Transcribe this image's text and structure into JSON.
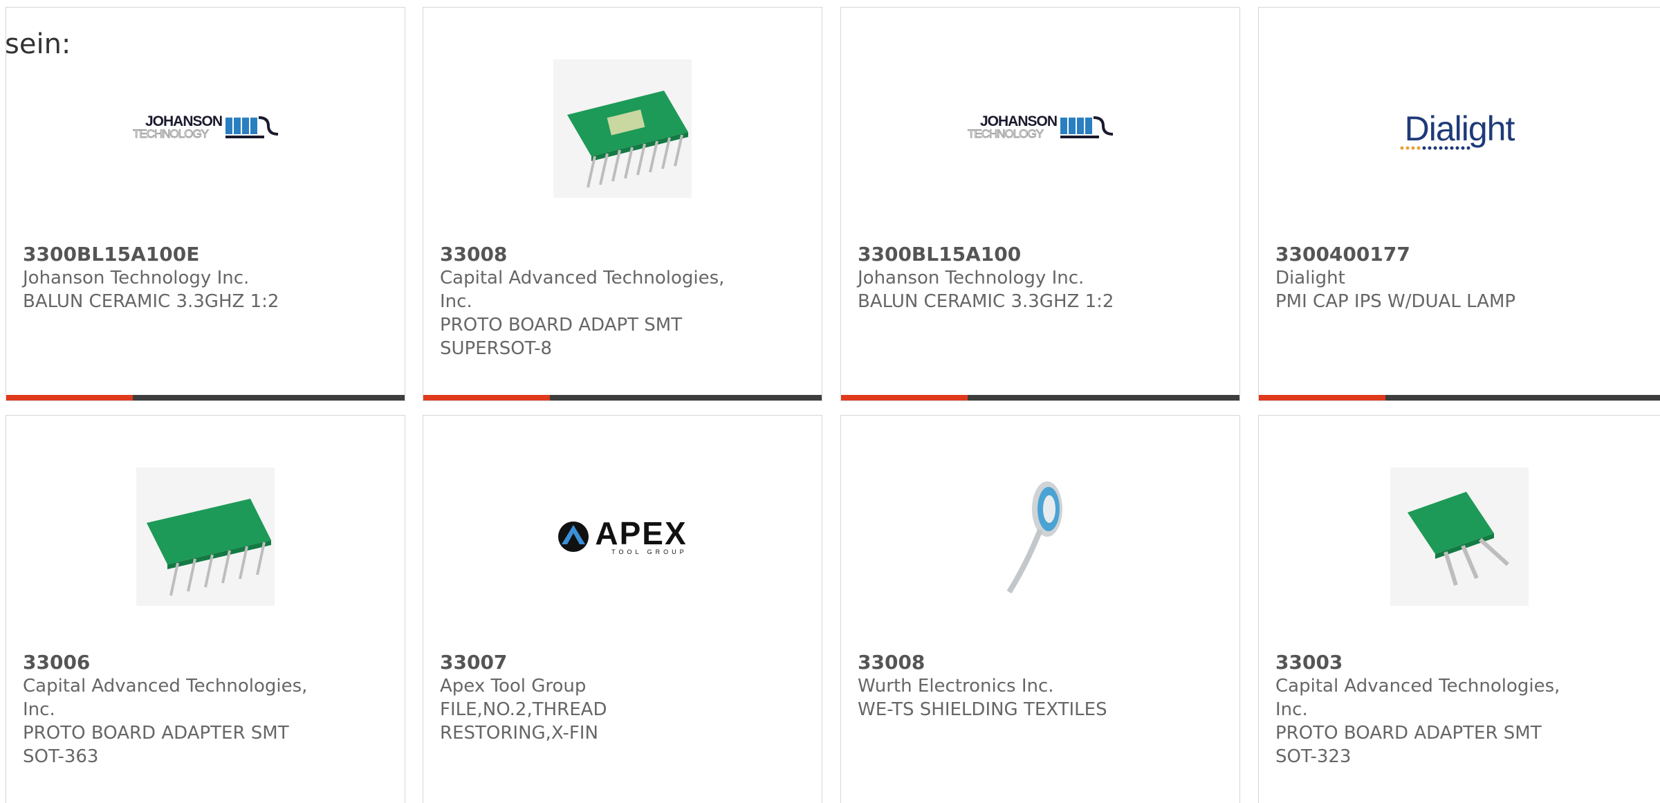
{
  "intro_text": "sein:",
  "colors": {
    "accent": "#e0391b",
    "bar": "#3d3d3d",
    "text": "#666666",
    "border": "#d6d6d6"
  },
  "products": [
    {
      "part_number": "3300BL15A100E",
      "manufacturer": "Johanson Technology Inc.",
      "description": "BALUN CERAMIC 3.3GHZ 1:2",
      "image": "johanson-logo",
      "logo_text": [
        "JOHANSON",
        "TECHNOLOGY"
      ]
    },
    {
      "part_number": "33008",
      "manufacturer": "Capital Advanced Technologies, Inc.",
      "description": "PROTO BOARD ADAPT SMT SUPERSOT-8",
      "image": "green-proto-board-8pin"
    },
    {
      "part_number": "3300BL15A100",
      "manufacturer": "Johanson Technology Inc.",
      "description": "BALUN CERAMIC 3.3GHZ 1:2",
      "image": "johanson-logo",
      "logo_text": [
        "JOHANSON",
        "TECHNOLOGY"
      ]
    },
    {
      "part_number": "3300400177",
      "manufacturer": "Dialight",
      "description": "PMI CAP IPS W/DUAL LAMP",
      "image": "dialight-logo",
      "logo_text": [
        "Dialight"
      ]
    },
    {
      "part_number": "33006",
      "manufacturer": "Capital Advanced Technologies, Inc.",
      "description": "PROTO BOARD ADAPTER SMT SOT-363",
      "image": "green-proto-board-6pin"
    },
    {
      "part_number": "33007",
      "manufacturer": "Apex Tool Group",
      "description": "FILE,NO.2,THREAD RESTORING,X-FIN",
      "image": "apex-logo",
      "logo_text": [
        "APEX",
        "TOOL GROUP"
      ]
    },
    {
      "part_number": "33008",
      "manufacturer": "Wurth Electronics Inc.",
      "description": "WE-TS SHIELDING TEXTILES",
      "image": "shielding-tape-roll"
    },
    {
      "part_number": "33003",
      "manufacturer": "Capital Advanced Technologies, Inc.",
      "description": "PROTO BOARD ADAPTER SMT SOT-323",
      "image": "green-proto-board-3pin"
    }
  ]
}
